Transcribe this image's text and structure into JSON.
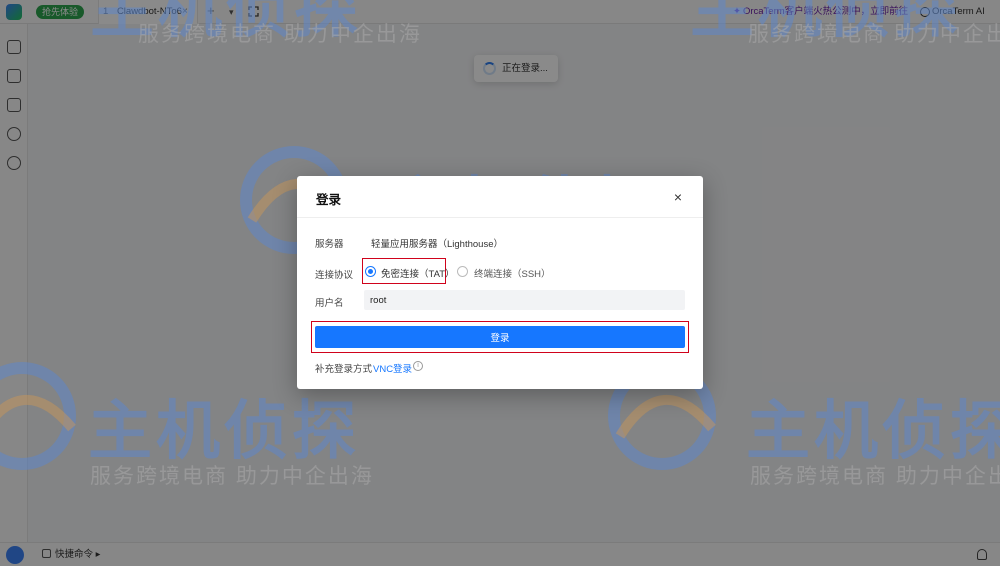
{
  "topbar": {
    "trial_label": "抢先体验",
    "tab": {
      "index": "1",
      "title": "Clawdbot-NTo6",
      "close": "×"
    },
    "add_tab": "+",
    "more_tabs": "▾",
    "promo_text": "OrcaTerm客户端火热公测中，立即前往",
    "ai_button": "OrcaTerm AI"
  },
  "sidebar": {
    "icons": [
      "dashboard-icon",
      "server-list-icon",
      "terminal-icon",
      "shield-icon",
      "plugin-icon"
    ]
  },
  "bottombar": {
    "quick_command": "快捷命令"
  },
  "toast": {
    "text": "正在登录..."
  },
  "watermark": {
    "title": "主机侦探",
    "subtitle": "服务跨境电商 助力中企出海"
  },
  "dialog": {
    "title": "登录",
    "close": "×",
    "server_label": "服务器",
    "server_value": "轻量应用服务器（Lighthouse）",
    "protocol_label": "连接协议",
    "protocol_options": [
      {
        "label": "免密连接（TAT）",
        "selected": true
      },
      {
        "label": "终端连接（SSH）",
        "selected": false
      }
    ],
    "username_label": "用户名",
    "username_value": "root",
    "login_button": "登录",
    "alt_login_label": "补充登录方式",
    "alt_login_link": "VNC登录",
    "info_glyph": "i"
  },
  "colors": {
    "primary": "#1677ff",
    "highlight": "#d0021b",
    "overlay": "rgba(0,0,0,0.46)"
  }
}
